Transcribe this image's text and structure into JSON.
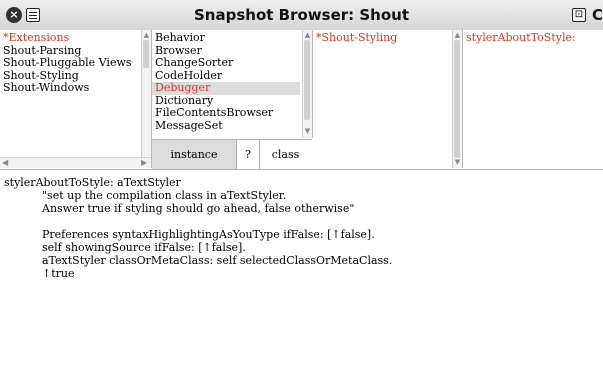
{
  "window": {
    "title": "Snapshot Browser: Shout",
    "close_glyph": "×",
    "collapse_glyph": "⊡",
    "edge_glyph": "C"
  },
  "categories": {
    "items": [
      {
        "label": "*Extensions",
        "selected": true
      },
      {
        "label": "Shout-Parsing"
      },
      {
        "label": "Shout-Pluggable Views"
      },
      {
        "label": "Shout-Styling"
      },
      {
        "label": "Shout-Windows"
      }
    ]
  },
  "classes": {
    "items": [
      {
        "label": "Behavior"
      },
      {
        "label": "Browser"
      },
      {
        "label": "ChangeSorter"
      },
      {
        "label": "CodeHolder"
      },
      {
        "label": "Debugger",
        "selected": true
      },
      {
        "label": "Dictionary"
      },
      {
        "label": "FileContentsBrowser"
      },
      {
        "label": "MessageSet"
      }
    ],
    "buttons": {
      "instance": "instance",
      "help": "?",
      "class": "class"
    }
  },
  "protocols": {
    "items": [
      {
        "label": "*Shout-Styling",
        "selected": true
      }
    ]
  },
  "methods": {
    "items": [
      {
        "label": "stylerAboutToStyle:",
        "selected": true
      }
    ]
  },
  "code": {
    "lines": [
      "stylerAboutToStyle: aTextStyler",
      "\"set up the compilation class in aTextStyler.",
      "Answer true if styling should go ahead, false otherwise\"",
      "",
      "Preferences syntaxHighlightingAsYouType ifFalse: [↑false].",
      "self showingSource ifFalse: [↑false].",
      "aTextStyler classOrMetaClass: self selectedClassOrMetaClass.",
      "↑true"
    ]
  },
  "colors": {
    "selected_text": "#e0341c",
    "highlight": "#dcdcdc",
    "titlebar": "#d6d6d6"
  }
}
